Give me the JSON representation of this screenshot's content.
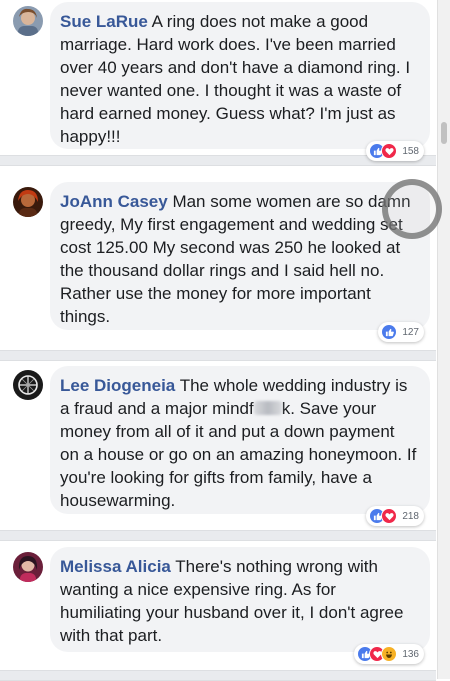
{
  "comments": [
    {
      "author": "Sue LaRue",
      "text": "A ring does not make a good marriage. Hard work does. I've been married over 40 years and don't have a diamond ring. I never wanted one. I thought it was a waste of hard earned money. Guess what? I'm just as happy!!!",
      "reactions": [
        "like",
        "love"
      ],
      "count": "158"
    },
    {
      "author": "JoAnn Casey",
      "text": "Man some women are so damn greedy, My first engagement and wedding set cost 125.00 My second was 250 he looked at the thousand dollar rings and I said hell no. Rather use the money for more important things.",
      "reactions": [
        "like"
      ],
      "count": "127"
    },
    {
      "author": "Lee Diogeneia",
      "text_before": "The whole wedding industry is a fraud and a major mindf",
      "text_after": "k. Save your money from all of it and put a down payment on a house or go on an amazing honeymoon. If you're looking for gifts from family, have a housewarming.",
      "reactions": [
        "like",
        "love"
      ],
      "count": "218"
    },
    {
      "author": "Melissa Alicia",
      "text": "There's nothing wrong with wanting a nice expensive ring. As for humiliating your husband over it, I don't agree with that part.",
      "reactions": [
        "like",
        "love",
        "haha"
      ],
      "count": "136"
    }
  ],
  "icons": {
    "like": "thumbs-up-icon",
    "love": "heart-icon",
    "haha": "laugh-icon"
  },
  "colors": {
    "author": "#385898",
    "bubble": "#f2f3f5",
    "separator": "#e9ebee",
    "like": "#4b7bec",
    "love": "#f0284a",
    "haha": "#f7b125"
  }
}
